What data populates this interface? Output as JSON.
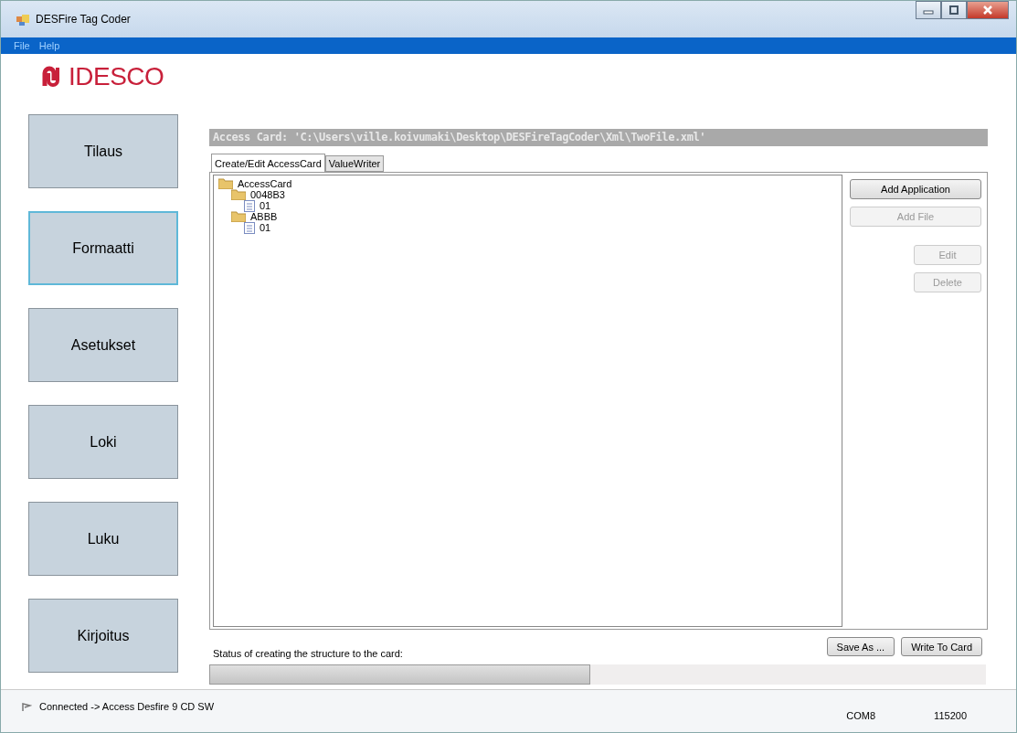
{
  "window": {
    "title": "DESFire Tag Coder"
  },
  "menu": [
    "File",
    "Help"
  ],
  "logo": {
    "text": "IDESCO"
  },
  "nav": [
    {
      "label": "Tilaus",
      "selected": false
    },
    {
      "label": "Formaatti",
      "selected": true
    },
    {
      "label": "Asetukset",
      "selected": false
    },
    {
      "label": "Loki",
      "selected": false
    },
    {
      "label": "Luku",
      "selected": false
    },
    {
      "label": "Kirjoitus",
      "selected": false
    }
  ],
  "header": "Access Card: 'C:\\Users\\ville.koivumaki\\Desktop\\DESFireTagCoder\\Xml\\TwoFile.xml'",
  "tabs": [
    {
      "label": "Create/Edit AccessCard",
      "selected": true
    },
    {
      "label": "ValueWriter",
      "selected": false
    }
  ],
  "tree": [
    {
      "label": "AccessCard",
      "kind": "folder",
      "children": [
        {
          "label": "0048B3",
          "kind": "folder",
          "children": [
            {
              "label": "01",
              "kind": "file"
            }
          ]
        },
        {
          "label": "ABBB",
          "kind": "folder",
          "children": [
            {
              "label": "01",
              "kind": "file"
            }
          ]
        }
      ]
    }
  ],
  "actions": [
    {
      "label": "Add Application",
      "disabled": false,
      "kind": "wide"
    },
    {
      "label": "Add File",
      "disabled": true,
      "kind": "wide"
    },
    {
      "label": "Edit",
      "disabled": true,
      "kind": "small"
    },
    {
      "label": "Delete",
      "disabled": true,
      "kind": "small"
    }
  ],
  "status_label": "Status of creating the structure to the card:",
  "footer_buttons": [
    "Save As ...",
    "Write To Card"
  ],
  "progress": {
    "level": 0.49
  },
  "status_bar": {
    "connection": "Connected -> Access Desfire 9 CD SW",
    "port": "COM8",
    "baud": "115200"
  }
}
